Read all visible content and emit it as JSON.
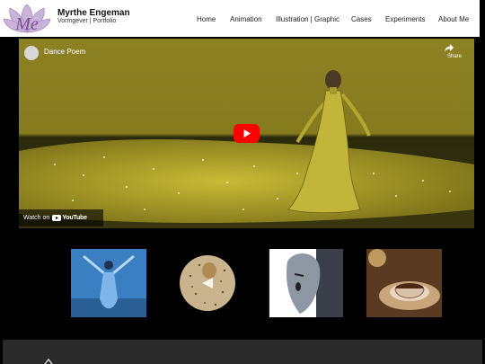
{
  "header": {
    "brand_name": "Myrthe Engeman",
    "brand_subtitle": "Vormgever | Portfolio",
    "logo_text": "Me"
  },
  "nav": {
    "items": [
      {
        "label": "Home"
      },
      {
        "label": "Animation"
      },
      {
        "label": "Illustration | Graphic"
      },
      {
        "label": "Cases"
      },
      {
        "label": "Experiments"
      },
      {
        "label": "About Me"
      }
    ]
  },
  "video": {
    "title": "Dance Poem",
    "share_label": "Share",
    "watch_on_label": "Watch on",
    "youtube_wordmark": "YouTube"
  },
  "colors": {
    "header_bg": "#ffffff",
    "page_bg": "#000000",
    "logo_purple": "#a07ab8",
    "youtube_red": "#ff0000",
    "video_olive": "#8a7f1f",
    "footer_bg": "#2a2a2a"
  },
  "thumbnails": [
    {
      "name": "dancer-blue-thumbnail"
    },
    {
      "name": "cookie-face-thumbnail"
    },
    {
      "name": "mask-portrait-thumbnail"
    },
    {
      "name": "teacup-thumbnail"
    }
  ]
}
